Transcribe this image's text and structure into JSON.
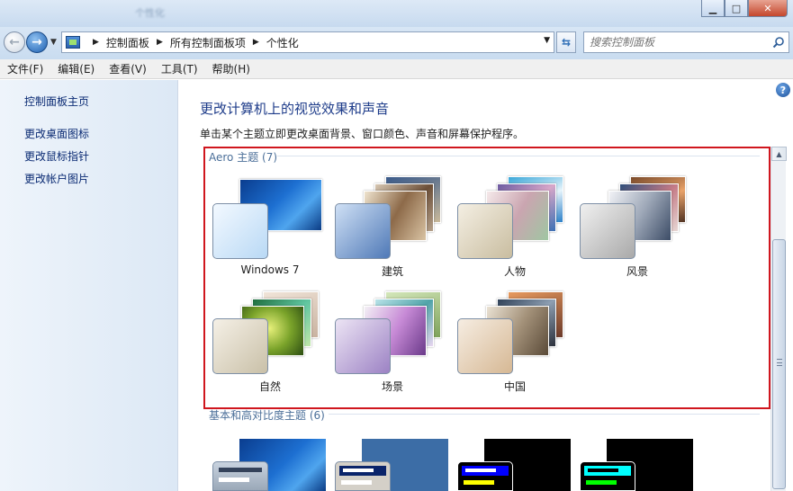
{
  "window": {
    "title": "个性化"
  },
  "address": {
    "crumbs": [
      "控制面板",
      "所有控制面板项",
      "个性化"
    ],
    "search_placeholder": "搜索控制面板"
  },
  "menu": [
    "文件(F)",
    "编辑(E)",
    "查看(V)",
    "工具(T)",
    "帮助(H)"
  ],
  "sidebar": {
    "items": [
      "控制面板主页",
      "更改桌面图标",
      "更改鼠标指针",
      "更改帐户图片"
    ]
  },
  "main": {
    "heading": "更改计算机上的视觉效果和声音",
    "subtext": "单击某个主题立即更改桌面背景、窗口颜色、声音和屏幕保护程序。",
    "aero_group": "Aero 主题 (7)",
    "aero_themes": [
      {
        "label": "Windows 7"
      },
      {
        "label": "建筑"
      },
      {
        "label": "人物"
      },
      {
        "label": "风景"
      },
      {
        "label": "自然"
      },
      {
        "label": "场景"
      },
      {
        "label": "中国"
      }
    ],
    "basic_group": "基本和高对比度主题 (6)"
  },
  "help_icon": "?",
  "colors": {
    "highlight": "#d0161e",
    "link": "#0a2a73",
    "heading": "#1e3c8a"
  }
}
